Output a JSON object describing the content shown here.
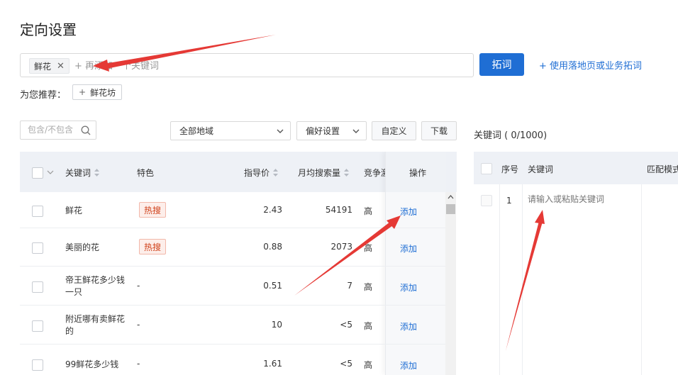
{
  "page": {
    "title": "定向设置"
  },
  "search": {
    "tag_label": "鲜花",
    "placeholder": "+ 再添加一个关键词"
  },
  "actions": {
    "expand_label": "拓词",
    "landing_link": "+ 使用落地页或业务拓词"
  },
  "recommend": {
    "label": "为您推荐：",
    "chip_plus": "+",
    "chip_label": "鲜花坊"
  },
  "filters": {
    "keyword_placeholder": "包含/不包含",
    "region_value": "全部地域",
    "preference_value": "偏好设置",
    "custom_label": "自定义",
    "download_label": "下载"
  },
  "table": {
    "columns": {
      "keyword": "关键词",
      "feature": "特色",
      "price": "指导价",
      "volume": "月均搜索量",
      "competition": "竞争激烈程度",
      "operation": "操作"
    },
    "rows": [
      {
        "keyword": "鲜花",
        "feature": "热搜",
        "price": "2.43",
        "volume": "54191",
        "competition": "高",
        "action": "添加"
      },
      {
        "keyword": "美丽的花",
        "feature": "热搜",
        "price": "0.88",
        "volume": "2073",
        "competition": "高",
        "action": "添加"
      },
      {
        "keyword": "帝王鲜花多少钱一只",
        "feature": "-",
        "price": "0.51",
        "volume": "7",
        "competition": "高",
        "action": "添加"
      },
      {
        "keyword": "附近哪有卖鲜花的",
        "feature": "-",
        "price": "10",
        "volume": "<5",
        "competition": "高",
        "action": "添加"
      },
      {
        "keyword": "99鲜花多少钱",
        "feature": "-",
        "price": "1.61",
        "volume": "<5",
        "competition": "高",
        "action": "添加"
      }
    ]
  },
  "right_panel": {
    "title": "关键词 ( 0/1000)",
    "columns": {
      "index": "序号",
      "keyword": "关键词",
      "match": "匹配模式"
    },
    "row_index": "1",
    "input_placeholder": "请输入或粘贴关键词"
  },
  "colors": {
    "primary": "#1f6ed4",
    "hot_badge": "#d0421b",
    "annotation_arrow": "#e53935"
  }
}
